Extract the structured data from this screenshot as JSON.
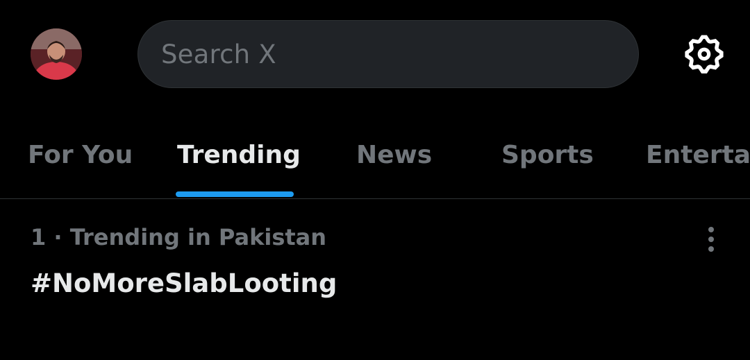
{
  "header": {
    "search_placeholder": "Search X",
    "avatar_icon": "user-avatar",
    "settings_icon": "gear-icon"
  },
  "tabs": [
    {
      "label": "For You",
      "active": false
    },
    {
      "label": "Trending",
      "active": true
    },
    {
      "label": "News",
      "active": false
    },
    {
      "label": "Sports",
      "active": false
    },
    {
      "label": "Entertai",
      "active": false
    }
  ],
  "trends": [
    {
      "meta": "1 · Trending in Pakistan",
      "title": "#NoMoreSlabLooting",
      "more_icon": "more-vertical-icon"
    }
  ],
  "colors": {
    "background": "#000000",
    "accent": "#1d9bf0",
    "text_primary": "#e7e9ea",
    "text_secondary": "#71767b",
    "search_bg": "#202327"
  }
}
